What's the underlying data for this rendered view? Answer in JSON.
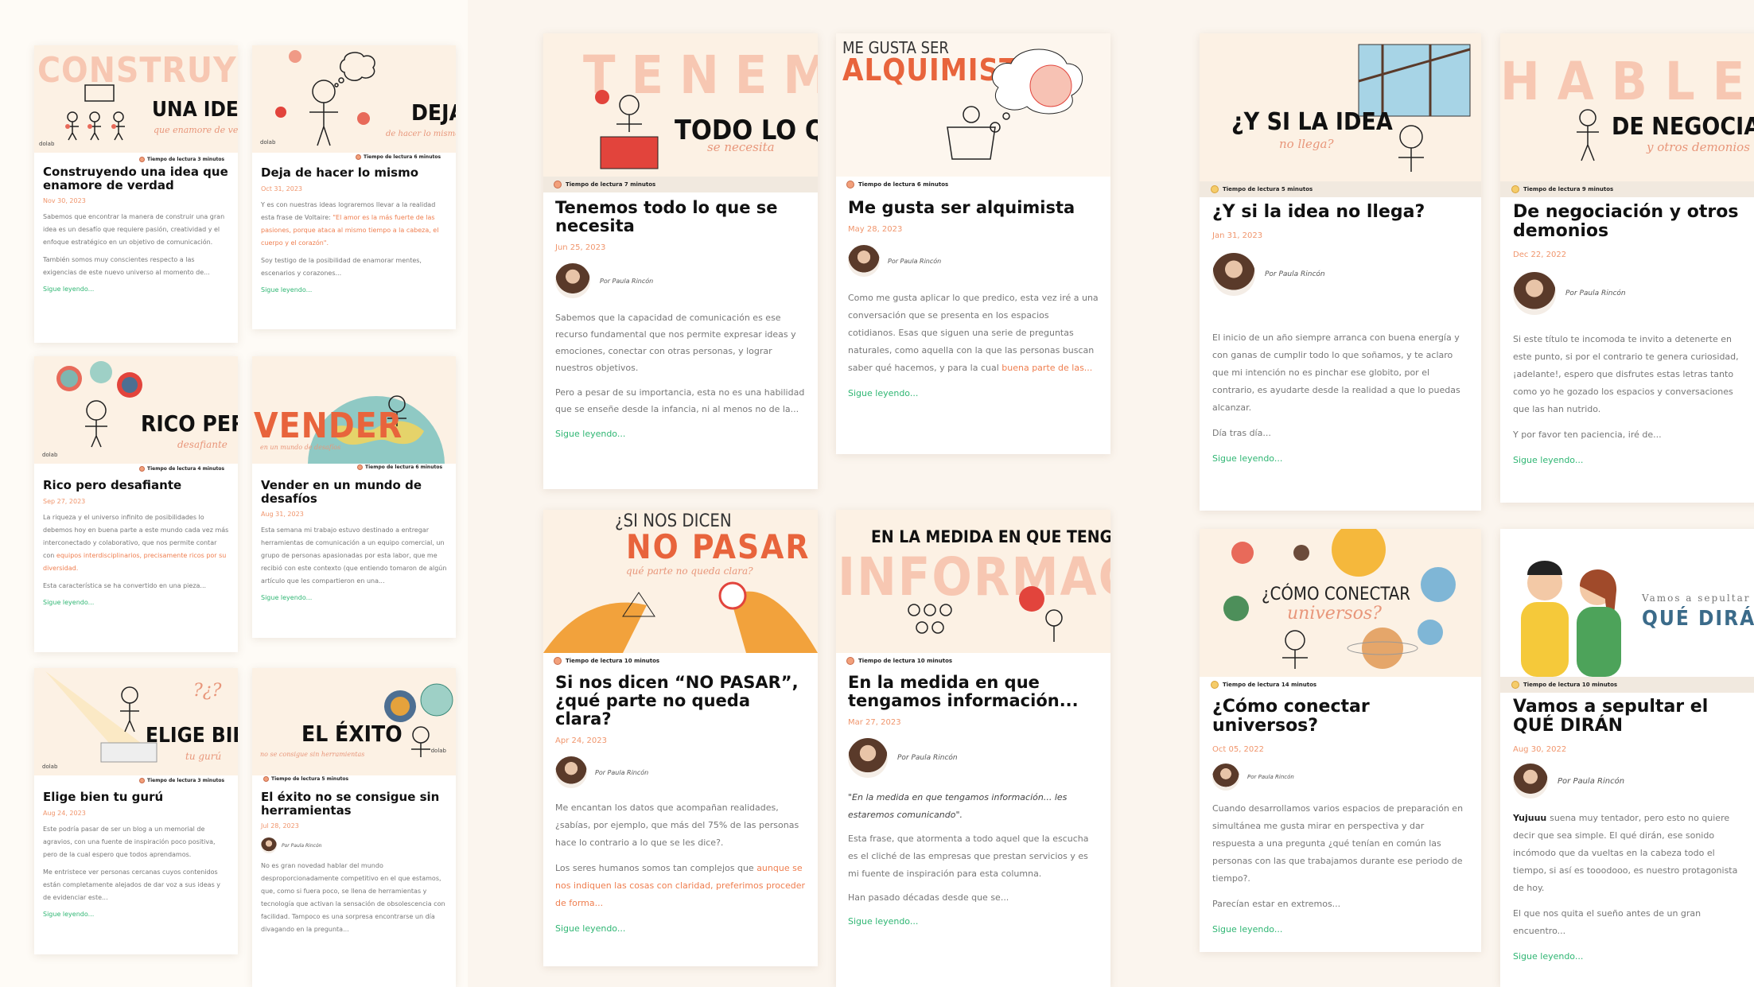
{
  "reading_prefix": "Tiempo de lectura",
  "read_more": "Sigue leyendo...",
  "panel1": [
    {
      "title": "Construyendo una idea que enamore de verdad",
      "date": "Nov 30, 2023",
      "read": "Tiempo de lectura 3 minutos",
      "big": "UNA IDEA",
      "ghost": "CONSTRUYENDO",
      "script": "que enamore de verdad",
      "logo": "dolab",
      "p1": "Sabemos que encontrar la manera de construir una gran idea es un desafío que requiere pasión, creatividad y el enfoque estratégico en un objetivo de comunicación.",
      "p2": "También somos muy conscientes respecto a las exigencias de este nuevo universo al momento de..."
    },
    {
      "title": "Deja de hacer lo mismo",
      "date": "Oct 31, 2023",
      "read": "Tiempo de lectura 6 minutos",
      "big": "DEJA",
      "script": "de hacer lo mismo",
      "logo": "dolab",
      "p1a": "Y es con nuestras ideas lograremos llevar a la realidad esta frase de Voltaire: ",
      "p1h": "\"El amor es la más fuerte de las pasiones, porque ataca al mismo tiempo a la cabeza, el cuerpo y el corazón\".",
      "p2": "Soy testigo de la posibilidad de enamorar mentes, escenarios y corazones..."
    },
    {
      "title": "Rico pero desafiante",
      "date": "Sep 27, 2023",
      "read": "Tiempo de lectura 4 minutos",
      "big": "RICO PERO",
      "script": "desafiante",
      "logo": "dolab",
      "p1a": "La riqueza y el universo infinito de posibilidades lo debemos hoy en buena parte a este mundo cada vez más interconectado y colaborativo, que nos permite contar con ",
      "p1h": "equipos interdisciplinarios, precisamente ricos por su diversidad.",
      "p2": "Esta característica se ha convertido en una pieza..."
    },
    {
      "title": "Vender en un mundo de desafíos",
      "date": "Aug 31, 2023",
      "read": "Tiempo de lectura 6 minutos",
      "big": "VENDER",
      "script": "en un mundo de desafíos",
      "p1": "Esta semana mi trabajo estuvo destinado a entregar herramientas de comunicación a un equipo comercial, un grupo de personas apasionadas por esta labor, que me recibió con este contexto (que entiendo tomaron de algún artículo que les compartieron en una..."
    },
    {
      "title": "Elige bien tu gurú",
      "date": "Aug 24, 2023",
      "read": "Tiempo de lectura 3 minutos",
      "big": "ELIGE BIEN",
      "script": "tu gurú",
      "logo": "dolab",
      "p1": "Este podría pasar de ser un blog a un memorial de agravios, con una fuente de inspiración poco positiva, pero de la cual espero que todos aprendamos.",
      "p2": "Me entristece ver personas cercanas cuyos contenidos están completamente alejados de dar voz a sus ideas y de evidenciar este..."
    },
    {
      "title": "El éxito no se consigue sin herramientas",
      "date": "Jul 28, 2023",
      "read": "Tiempo de lectura 5 minutos",
      "big": "EL ÉXITO",
      "script": "no se consigue sin herramientas",
      "logo": "dolab",
      "author": "Por Paula Rincón",
      "p1": "No es gran novedad hablar del mundo desproporcionadamente competitivo en el que estamos, que, como si fuera poco, se llena de herramientas y tecnología que activan la sensación de obsolescencia con facilidad. Tampoco es una sorpresa encontrarse un día divagando en la pregunta..."
    }
  ],
  "panel2": [
    {
      "title": "Tenemos todo lo que se necesita",
      "date": "Jun 25, 2023",
      "read": "Tiempo de lectura 7 minutos",
      "ghost": "TENEMOS",
      "big": "TODO LO QUE",
      "script": "se necesita",
      "author": "Por Paula Rincón",
      "p1": "Sabemos que la capacidad de comunicación es ese recurso fundamental que nos permite expresar ideas y emociones, conectar con otras personas, y lograr nuestros objetivos.",
      "p2": "Pero a pesar de su importancia, esta no es una habilidad que se enseñe desde la infancia, ni al menos no de la..."
    },
    {
      "title": "Me gusta ser alquimista",
      "date": "May 28, 2023",
      "read": "Tiempo de lectura 6 minutos",
      "top": "ME GUSTA SER",
      "ghost": "ALQUIMISTA",
      "author": "Por Paula Rincón",
      "p1a": "Como me gusta aplicar lo que predico, esta vez iré a una conversación que se presenta en los espacios cotidianos. Esas que siguen una serie de preguntas naturales, como aquella con la que las personas buscan saber qué hacemos, y para la cual ",
      "p1h": "buena parte de las...",
      "p2": ""
    },
    {
      "title": "Si nos dicen “NO PASAR”, ¿qué parte no queda clara?",
      "date": "Apr 24, 2023",
      "read": "Tiempo de lectura 10 minutos",
      "top": "¿SI NOS DICEN",
      "big": "NO PASAR",
      "script": "qué parte no queda clara?",
      "author": "Por Paula Rincón",
      "p1": "Me encantan los datos que acompañan realidades, ¿sabías, por ejemplo, que más del 75% de las personas hace lo contrario a lo que se les dice?.",
      "p2a": "Los seres humanos somos tan complejos que ",
      "p2h": "aunque se nos indiquen las cosas con claridad, preferimos proceder de forma..."
    },
    {
      "title": "En la medida en que tengamos información...",
      "date": "Mar 27, 2023",
      "read": "Tiempo de lectura 10 minutos",
      "top": "EN LA MEDIDA EN QUE TENGAMOS",
      "ghost": "INFORMACIÓN",
      "author": "Por Paula Rincón",
      "quote": "\"En la medida en que tengamos información... les estaremos comunicando\".",
      "p1": "Esta frase, que atormenta a todo aquel que la escucha es el cliché de las empresas que prestan servicios y es mi fuente de inspiración para esta columna.",
      "p2": "Han pasado décadas desde que se..."
    }
  ],
  "panel3": [
    {
      "title": "¿Y si la idea no llega?",
      "date": "Jan 31, 2023",
      "read": "Tiempo de lectura 5 minutos",
      "big": "¿Y SI LA IDEA",
      "script": "no llega?",
      "author": "Por Paula Rincón",
      "p1": "El inicio de un año siempre arranca con buena energía y con ganas de cumplir todo lo que soñamos, y te aclaro que mi intención no es pinchar ese globito, por el contrario, es ayudarte desde la realidad a que lo puedas alcanzar.",
      "p2": "Día tras día..."
    },
    {
      "title": "De negociación y otros demonios",
      "date": "Dec 22, 2022",
      "read": "Tiempo de lectura 9 minutos",
      "ghost": "HABLEMOS",
      "big": "DE NEGOCIACIÓN",
      "script": "y otros demonios",
      "author": "Por Paula Rincón",
      "p1": "Si este título te incomoda te invito a detenerte en este punto, si por el contrario te genera curiosidad, ¡adelante!, espero que disfrutes estas letras tanto como yo he gozado los espacios y conversaciones que las han nutrido.",
      "p2": "Y por favor ten paciencia, iré de..."
    },
    {
      "title": "¿Cómo conectar universos?",
      "date": "Oct 05, 2022",
      "read": "Tiempo de lectura 14 minutos",
      "big": "¿CÓMO CONECTAR",
      "script": "universos?",
      "author": "Por Paula Rincón",
      "p1": "Cuando desarrollamos varios espacios de preparación en simultánea me gusta mirar en perspectiva y dar respuesta a una pregunta ¿qué tenían en común las personas con las que trabajamos durante ese periodo de tiempo?.",
      "p2": "Parecían estar en extremos..."
    },
    {
      "title": "Vamos a sepultar el QUÉ DIRÁN",
      "date": "Aug 30, 2022",
      "read": "Tiempo de lectura 10 minutos",
      "top": "Vamos a sepultar",
      "big": "QUÉ DIRÁN",
      "author": "Por Paula Rincón",
      "p1b": "Yujuuu ",
      "p1": "suena muy tentador, pero esto no quiere decir que sea simple. El qué dirán, ese sonido incómodo que da vueltas en la cabeza todo el tiempo, si así es tooodooo, es nuestro protagonista de hoy.",
      "p2": "El que nos quita el sueño antes de un gran encuentro..."
    }
  ]
}
